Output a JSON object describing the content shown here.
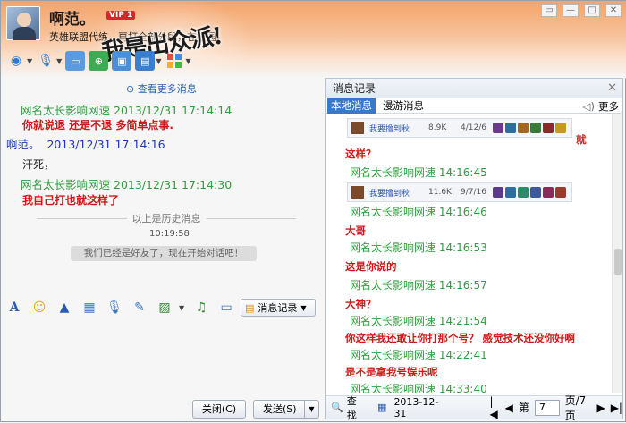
{
  "header": {
    "contact_name": "啊范。",
    "vip": "VIP 1",
    "signature": "英雄联盟代练，再打全部分段，在校园",
    "banner_text": "我是出众派!"
  },
  "toolbar_icons": [
    "video-call-icon",
    "voice-call-icon",
    "file-transfer-icon",
    "remote-assist-icon",
    "screen-share-icon",
    "app-icon",
    "more-apps-icon"
  ],
  "chat": {
    "more_messages": "查看更多消息",
    "messages": [
      {
        "sender": "网名太长影响网速",
        "time": "2013/12/31 17:14:14",
        "text": "你就说退  还是不退    多简单点事."
      },
      {
        "sender": "啊范。",
        "time": "2013/12/31 17:14:16",
        "text": "汗死，"
      },
      {
        "sender": "网名太长影响网速",
        "time": "2013/12/31 17:14:30",
        "text": "我自己打也就这样了"
      }
    ],
    "history_label": "以上是历史消息",
    "timestamp": "10:19:58",
    "system_notice": "我们已经是好友了，现在开始对话吧！"
  },
  "input_toolbar": {
    "record_label": "消息记录"
  },
  "buttons": {
    "close": "关闭(C)",
    "send": "发送(S)"
  },
  "history_panel": {
    "title": "消息记录",
    "tab_local": "本地消息",
    "tab_roaming": "漫游消息",
    "more": "更多",
    "entries": [
      {
        "kind": "red",
        "text": "就"
      },
      {
        "kind": "red",
        "text": "这样？"
      },
      {
        "kind": "green",
        "text": "网名太长影响网速  14:16:45"
      },
      {
        "kind": "green",
        "text": "网名太长影响网速  14:16:46"
      },
      {
        "kind": "red",
        "text": "大哥"
      },
      {
        "kind": "green",
        "text": "网名太长影响网速  14:16:53"
      },
      {
        "kind": "red",
        "text": "这是你说的"
      },
      {
        "kind": "green",
        "text": "网名太长影响网速  14:16:57"
      },
      {
        "kind": "red",
        "text": "大神？"
      },
      {
        "kind": "green",
        "text": "网名太长影响网速  14:21:54"
      },
      {
        "kind": "red",
        "text": "你这样我还敢让你打那个号？  感觉技术还没你好啊"
      },
      {
        "kind": "green",
        "text": "网名太长影响网速  14:22:41"
      },
      {
        "kind": "red",
        "text": "是不是拿我号娱乐呢"
      },
      {
        "kind": "green",
        "text": "网名太长影响网速  14:33:40"
      }
    ],
    "game_shots": [
      {
        "name": "我要撸到秋",
        "stat1": "8.9K",
        "stat2": "4/12/6"
      },
      {
        "name": "我要撸到秋",
        "stat1": "11.6K",
        "stat2": "9/7/16"
      }
    ],
    "footer": {
      "search": "查找",
      "date": "2013-12-31",
      "page_prefix": "第",
      "page_value": "7",
      "page_suffix": "页/7页"
    }
  }
}
